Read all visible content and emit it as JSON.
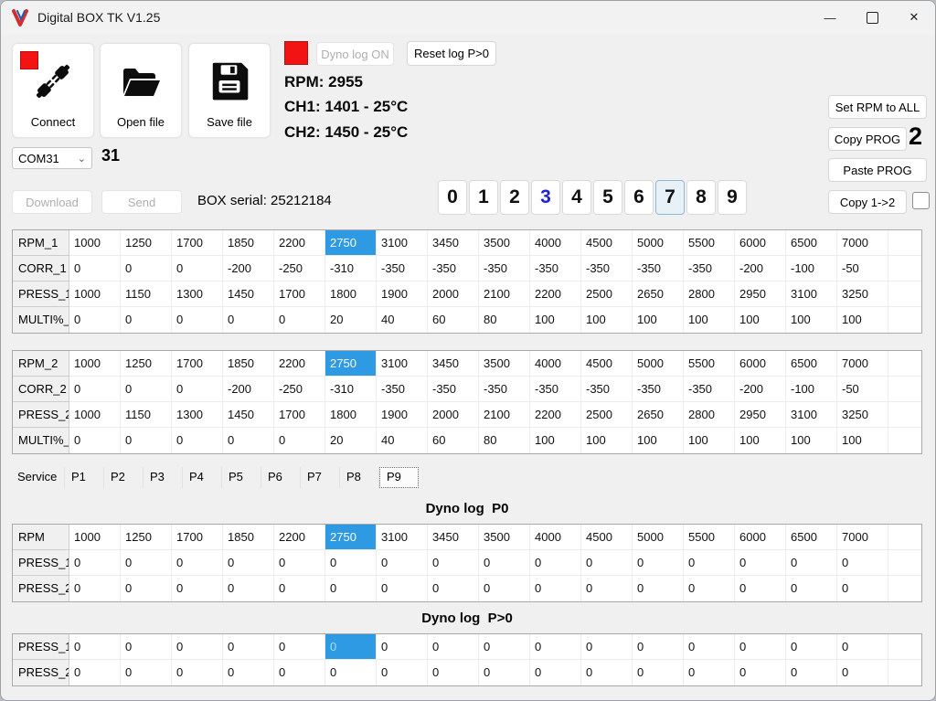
{
  "window": {
    "title": "Digital BOX TK V1.25",
    "controls": {
      "minimize": "—",
      "close": "✕"
    }
  },
  "toolbar": {
    "connect_label": "Connect",
    "open_label": "Open file",
    "save_label": "Save file",
    "dyno_log_label": "Dyno log ON",
    "reset_log_label": "Reset log P>0"
  },
  "status": {
    "rpm": "RPM: 2955",
    "ch1": "CH1: 1401 - 25°C",
    "ch2": "CH2: 1450 - 25°C"
  },
  "com": {
    "selected": "COM31",
    "number": "31"
  },
  "actions": {
    "download": "Download",
    "send": "Send",
    "box_serial": "BOX serial: 25212184",
    "set_rpm_all": "Set RPM to ALL",
    "copy_prog": "Copy PROG",
    "copy_prog_count": "2",
    "paste_prog": "Paste PROG",
    "copy_12": "Copy 1->2"
  },
  "prog_digits": {
    "items": [
      "0",
      "1",
      "2",
      "3",
      "4",
      "5",
      "6",
      "7",
      "8",
      "9"
    ],
    "selected": "7",
    "accent": "3"
  },
  "tabs": {
    "items": [
      "Service",
      "P1",
      "P2",
      "P3",
      "P4",
      "P5",
      "P6",
      "P7",
      "P8",
      "P9"
    ],
    "selected": "P9"
  },
  "headings": {
    "dyno_p0": "Dyno log  P0",
    "dyno_pgt0": "Dyno log  P>0"
  },
  "colors": {
    "highlight_blue": "#2d9ae3",
    "indicator_red": "#f21313",
    "digit_accent_blue": "#2323d6"
  },
  "tables": [
    {
      "id": "prog1",
      "rows": [
        {
          "label": "RPM_1",
          "hl": 5,
          "values": [
            "1000",
            "1250",
            "1700",
            "1850",
            "2200",
            "2750",
            "3100",
            "3450",
            "3500",
            "4000",
            "4500",
            "5000",
            "5500",
            "6000",
            "6500",
            "7000"
          ]
        },
        {
          "label": "CORR_1",
          "values": [
            "0",
            "0",
            "0",
            "-200",
            "-250",
            "-310",
            "-350",
            "-350",
            "-350",
            "-350",
            "-350",
            "-350",
            "-350",
            "-200",
            "-100",
            "-50"
          ]
        },
        {
          "label": "PRESS_1",
          "values": [
            "1000",
            "1150",
            "1300",
            "1450",
            "1700",
            "1800",
            "1900",
            "2000",
            "2100",
            "2200",
            "2500",
            "2650",
            "2800",
            "2950",
            "3100",
            "3250"
          ]
        },
        {
          "label": "MULTI%_",
          "values": [
            "0",
            "0",
            "0",
            "0",
            "0",
            "20",
            "40",
            "60",
            "80",
            "100",
            "100",
            "100",
            "100",
            "100",
            "100",
            "100"
          ]
        }
      ]
    },
    {
      "id": "prog2",
      "rows": [
        {
          "label": "RPM_2",
          "hl": 5,
          "values": [
            "1000",
            "1250",
            "1700",
            "1850",
            "2200",
            "2750",
            "3100",
            "3450",
            "3500",
            "4000",
            "4500",
            "5000",
            "5500",
            "6000",
            "6500",
            "7000"
          ]
        },
        {
          "label": "CORR_2",
          "values": [
            "0",
            "0",
            "0",
            "-200",
            "-250",
            "-310",
            "-350",
            "-350",
            "-350",
            "-350",
            "-350",
            "-350",
            "-350",
            "-200",
            "-100",
            "-50"
          ]
        },
        {
          "label": "PRESS_2",
          "values": [
            "1000",
            "1150",
            "1300",
            "1450",
            "1700",
            "1800",
            "1900",
            "2000",
            "2100",
            "2200",
            "2500",
            "2650",
            "2800",
            "2950",
            "3100",
            "3250"
          ]
        },
        {
          "label": "MULTI%_",
          "values": [
            "0",
            "0",
            "0",
            "0",
            "0",
            "20",
            "40",
            "60",
            "80",
            "100",
            "100",
            "100",
            "100",
            "100",
            "100",
            "100"
          ]
        }
      ]
    },
    {
      "id": "dyno_p0",
      "rows": [
        {
          "label": "RPM",
          "hl": 5,
          "values": [
            "1000",
            "1250",
            "1700",
            "1850",
            "2200",
            "2750",
            "3100",
            "3450",
            "3500",
            "4000",
            "4500",
            "5000",
            "5500",
            "6000",
            "6500",
            "7000"
          ]
        },
        {
          "label": "PRESS_1",
          "values": [
            "0",
            "0",
            "0",
            "0",
            "0",
            "0",
            "0",
            "0",
            "0",
            "0",
            "0",
            "0",
            "0",
            "0",
            "0",
            "0"
          ]
        },
        {
          "label": "PRESS_2",
          "values": [
            "0",
            "0",
            "0",
            "0",
            "0",
            "0",
            "0",
            "0",
            "0",
            "0",
            "0",
            "0",
            "0",
            "0",
            "0",
            "0"
          ]
        }
      ]
    },
    {
      "id": "dyno_pgt0",
      "rows": [
        {
          "label": "PRESS_1",
          "hl": 5,
          "hl_light": true,
          "values": [
            "0",
            "0",
            "0",
            "0",
            "0",
            "0",
            "0",
            "0",
            "0",
            "0",
            "0",
            "0",
            "0",
            "0",
            "0",
            "0"
          ]
        },
        {
          "label": "PRESS_2",
          "values": [
            "0",
            "0",
            "0",
            "0",
            "0",
            "0",
            "0",
            "0",
            "0",
            "0",
            "0",
            "0",
            "0",
            "0",
            "0",
            "0"
          ]
        }
      ]
    }
  ]
}
